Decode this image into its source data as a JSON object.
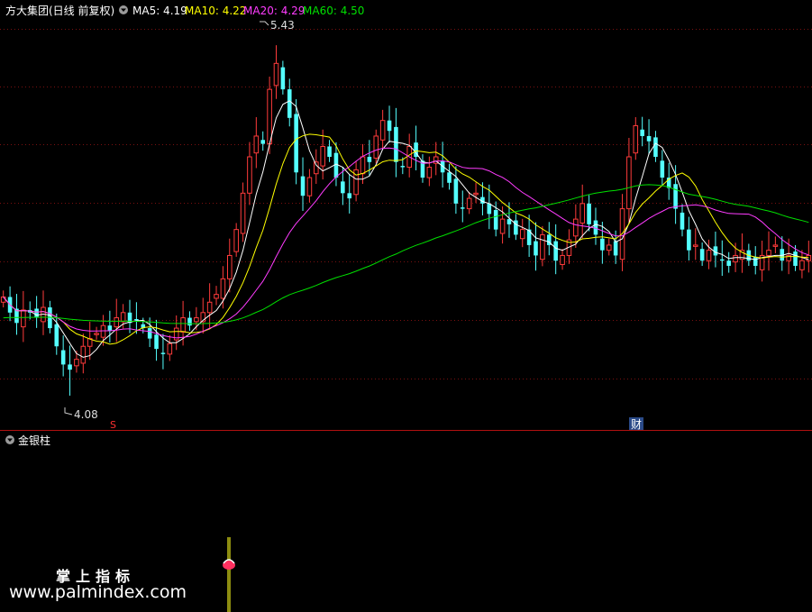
{
  "header": {
    "title": "方大集团(日线 前复权)",
    "ma": [
      {
        "label": "MA5: 4.19",
        "color": "#ffffff"
      },
      {
        "label": "MA10: 4.22",
        "color": "#ffff00"
      },
      {
        "label": "MA20: 4.29",
        "color": "#ff3cff"
      },
      {
        "label": "MA60: 4.50",
        "color": "#00e000"
      }
    ]
  },
  "markers": {
    "high_label": "5.43",
    "low_label": "4.08",
    "s_label": "S",
    "cai_label": "财"
  },
  "sub_panel": {
    "title": "金银柱"
  },
  "watermark": {
    "line1": "掌上指标",
    "line2": "www.palmindex.com"
  },
  "colors": {
    "up": "#ff3b3b",
    "down": "#54ffff",
    "ma5": "#ffffff",
    "ma10": "#ffff00",
    "ma20": "#ff3cff",
    "ma60": "#00e000",
    "grid": "#7a1010"
  },
  "chart_data": {
    "type": "candlestick",
    "price_range": [
      4.0,
      5.5
    ],
    "high": 5.43,
    "low": 4.08,
    "closes": [
      4.46,
      4.4,
      4.36,
      4.41,
      4.4,
      4.38,
      4.42,
      4.34,
      4.27,
      4.2,
      4.18,
      4.22,
      4.27,
      4.3,
      4.32,
      4.35,
      4.33,
      4.38,
      4.4,
      4.36,
      4.37,
      4.34,
      4.3,
      4.26,
      4.24,
      4.28,
      4.34,
      4.38,
      4.35,
      4.38,
      4.4,
      4.44,
      4.47,
      4.53,
      4.62,
      4.72,
      4.86,
      5.0,
      5.08,
      5.05,
      5.26,
      5.36,
      5.26,
      5.15,
      4.94,
      4.85,
      4.92,
      4.98,
      5.04,
      5.0,
      4.92,
      4.86,
      4.84,
      4.95,
      5.0,
      4.98,
      5.08,
      5.14,
      5.1,
      4.98,
      4.96,
      5.04,
      5.0,
      4.92,
      4.96,
      5.0,
      4.94,
      4.9,
      4.82,
      4.8,
      4.84,
      4.86,
      4.82,
      4.78,
      4.72,
      4.76,
      4.74,
      4.7,
      4.72,
      4.66,
      4.62,
      4.7,
      4.66,
      4.6,
      4.62,
      4.68,
      4.76,
      4.82,
      4.74,
      4.7,
      4.64,
      4.66,
      4.62,
      4.8,
      5.0,
      5.12,
      5.08,
      5.06,
      5.0,
      4.92,
      4.88,
      4.8,
      4.72,
      4.64,
      4.66,
      4.6,
      4.64,
      4.62,
      4.6,
      4.58,
      4.62,
      4.64,
      4.6,
      4.58,
      4.62,
      4.64,
      4.66,
      4.6,
      4.62,
      4.58,
      4.6,
      4.62
    ],
    "ma_last": {
      "MA5": 4.19,
      "MA10": 4.22,
      "MA20": 4.29,
      "MA60": 4.5
    }
  }
}
